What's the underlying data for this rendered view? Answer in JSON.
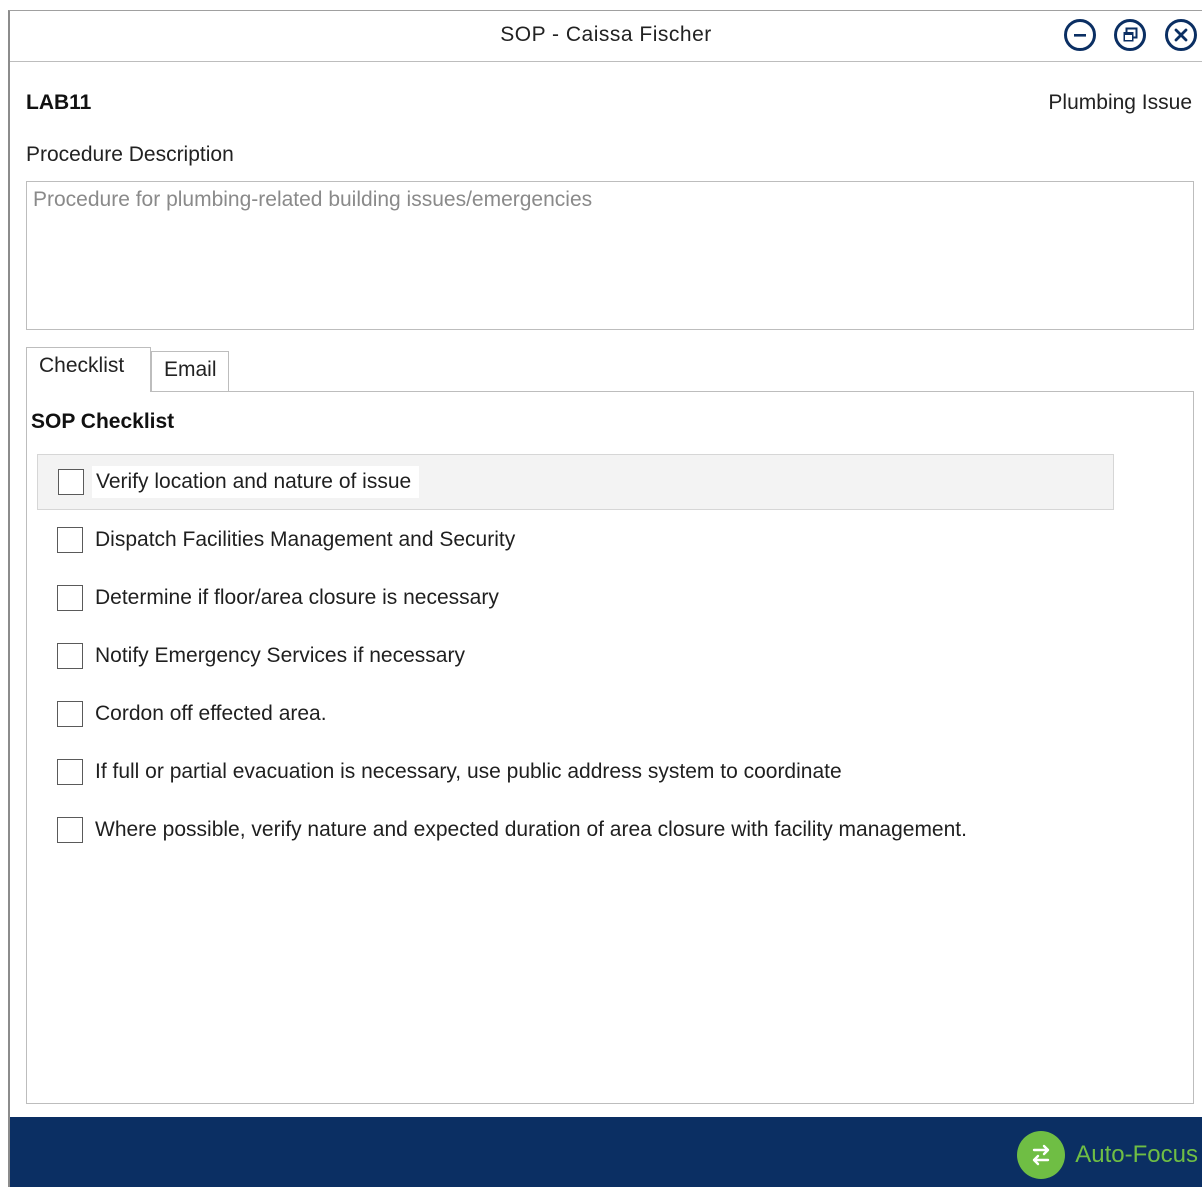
{
  "window": {
    "title": "SOP - Caissa Fischer",
    "controls": [
      "minimize-icon",
      "restore-icon",
      "close-icon"
    ]
  },
  "header": {
    "id": "LAB11",
    "category": "Plumbing Issue"
  },
  "description": {
    "label": "Procedure Description",
    "value": "Procedure for plumbing-related building issues/emergencies"
  },
  "tabs": [
    {
      "label": "Checklist",
      "active": true
    },
    {
      "label": "Email",
      "active": false
    }
  ],
  "checklist": {
    "title": "SOP Checklist",
    "items": [
      {
        "label": "Verify location and nature of issue",
        "checked": false
      },
      {
        "label": "Dispatch Facilities Management and Security",
        "checked": false
      },
      {
        "label": "Determine if floor/area closure is necessary",
        "checked": false
      },
      {
        "label": "Notify Emergency Services if necessary",
        "checked": false
      },
      {
        "label": "Cordon off effected area.",
        "checked": false
      },
      {
        "label": "If full or partial evacuation is necessary, use public address system to coordinate",
        "checked": false
      },
      {
        "label": "Where possible, verify nature and expected duration of area closure with facility management.",
        "checked": false
      }
    ]
  },
  "footer": {
    "autofocus_label": "Auto-Focus",
    "autofocus_icon": "swap-arrows-icon"
  },
  "colors": {
    "footer_bg": "#0b2f63",
    "accent_green": "#6fbe44",
    "title_icon": "#0b2f63"
  }
}
